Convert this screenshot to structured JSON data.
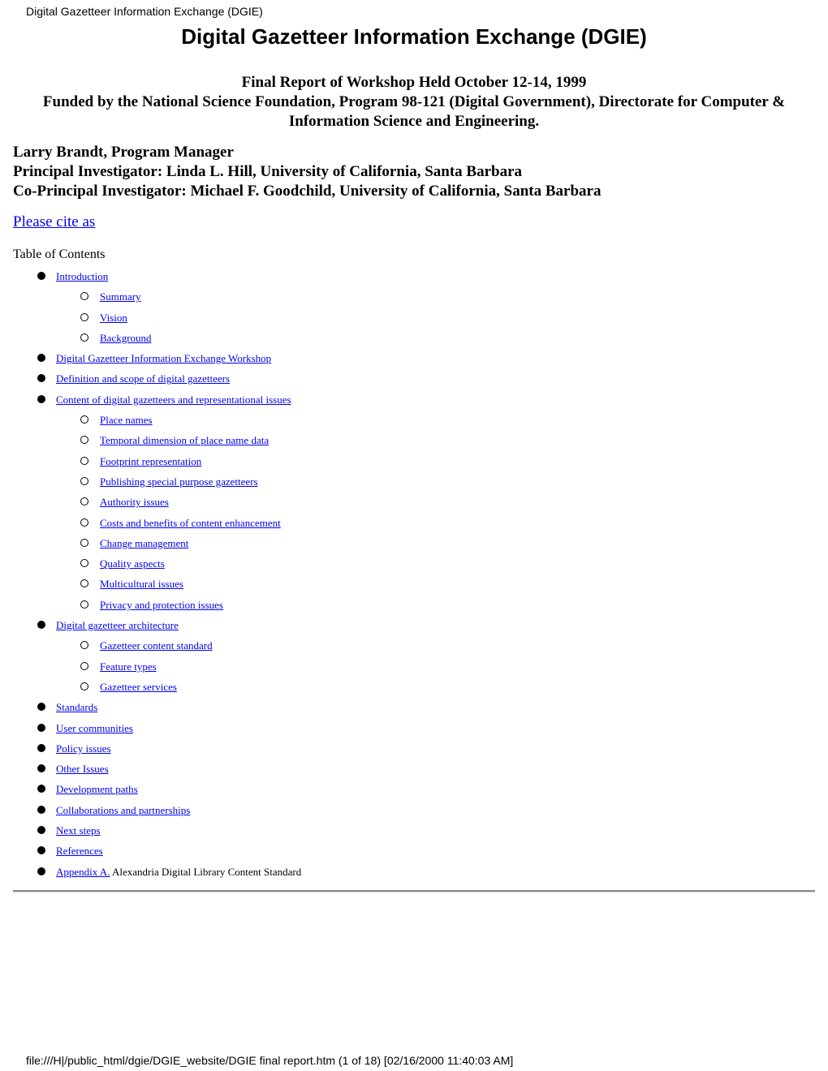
{
  "page_header": "Digital Gazetteer Information Exchange (DGIE)",
  "title": "Digital Gazetteer Information Exchange (DGIE)",
  "subtitle": {
    "line1": "Final Report of Workshop Held October 12-14, 1999",
    "line2": "Funded by the National Science Foundation, Program 98-121 (Digital Government), Directorate for Computer & Information Science and Engineering."
  },
  "people": [
    "Larry Brandt, Program Manager",
    "Principal Investigator: Linda L. Hill, University of California, Santa Barbara",
    "Co-Principal Investigator: Michael F. Goodchild, University of California, Santa Barbara"
  ],
  "cite_link": "Please cite as",
  "toc": {
    "title": "Table of Contents",
    "items": [
      {
        "level": 1,
        "label": "Introduction"
      },
      {
        "level": 2,
        "label": "Summary"
      },
      {
        "level": 2,
        "label": "Vision"
      },
      {
        "level": 2,
        "label": "Background"
      },
      {
        "level": 1,
        "label": "Digital Gazetteer Information Exchange Workshop"
      },
      {
        "level": 1,
        "label": "Definition and scope of digital gazetteers"
      },
      {
        "level": 1,
        "label": "Content of digital gazetteers and representational issues"
      },
      {
        "level": 2,
        "label": "Place names"
      },
      {
        "level": 2,
        "label": "Temporal dimension of place name data"
      },
      {
        "level": 2,
        "label": "Footprint representation"
      },
      {
        "level": 2,
        "label": "Publishing special purpose gazetteers"
      },
      {
        "level": 2,
        "label": "Authority issues"
      },
      {
        "level": 2,
        "label": "Costs and benefits of content enhancement"
      },
      {
        "level": 2,
        "label": "Change management"
      },
      {
        "level": 2,
        "label": "Quality aspects"
      },
      {
        "level": 2,
        "label": "Multicultural issues"
      },
      {
        "level": 2,
        "label": "Privacy and protection issues"
      },
      {
        "level": 1,
        "label": "Digital gazetteer architecture"
      },
      {
        "level": 2,
        "label": "Gazetteer content standard"
      },
      {
        "level": 2,
        "label": "Feature types"
      },
      {
        "level": 2,
        "label": "Gazetteer services"
      },
      {
        "level": 1,
        "label": "Standards"
      },
      {
        "level": 1,
        "label": "User communities"
      },
      {
        "level": 1,
        "label": "Policy issues"
      },
      {
        "level": 1,
        "label": "Other Issues"
      },
      {
        "level": 1,
        "label": "Development paths"
      },
      {
        "level": 1,
        "label": "Collaborations and partnerships"
      },
      {
        "level": 1,
        "label": "Next steps"
      },
      {
        "level": 1,
        "label": "References"
      },
      {
        "level": 1,
        "label": "Appendix A.",
        "suffix": " Alexandria Digital Library Content Standard"
      }
    ]
  },
  "footer": "file:///H|/public_html/dgie/DGIE_website/DGIE final report.htm (1 of 18) [02/16/2000 11:40:03 AM]"
}
